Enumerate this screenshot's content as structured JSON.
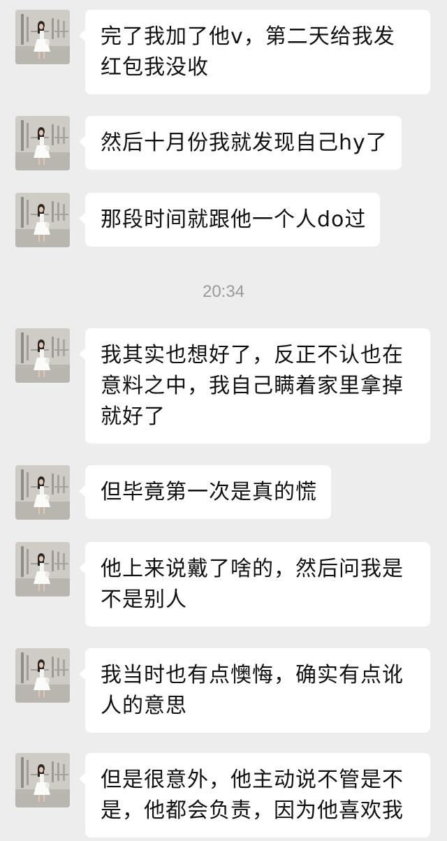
{
  "messages": [
    {
      "text": "完了我加了他v，第二天给我发红包我没收",
      "avatar_icon": "avatar-girl-photo"
    },
    {
      "text": "然后十月份我就发现自己hy了",
      "avatar_icon": "avatar-girl-photo"
    },
    {
      "text": "那段时间就跟他一个人do过",
      "avatar_icon": "avatar-girl-photo"
    },
    {
      "text": "我其实也想好了，反正不认也在意料之中，我自己瞒着家里拿掉就好了",
      "avatar_icon": "avatar-girl-photo"
    },
    {
      "text": "但毕竟第一次是真的慌",
      "avatar_icon": "avatar-girl-photo"
    },
    {
      "text": "他上来说戴了啥的，然后问我是不是别人",
      "avatar_icon": "avatar-girl-photo"
    },
    {
      "text": "我当时也有点懊悔，确实有点讹人的意思",
      "avatar_icon": "avatar-girl-photo"
    },
    {
      "text": "但是很意外，他主动说不管是不是，他都会负责，因为他喜欢我",
      "avatar_icon": "avatar-girl-photo"
    }
  ],
  "timestamp": "20:34",
  "colors": {
    "background": "#ededed",
    "bubble": "#ffffff",
    "text": "#111111",
    "timestamp": "#9a9a9a"
  }
}
